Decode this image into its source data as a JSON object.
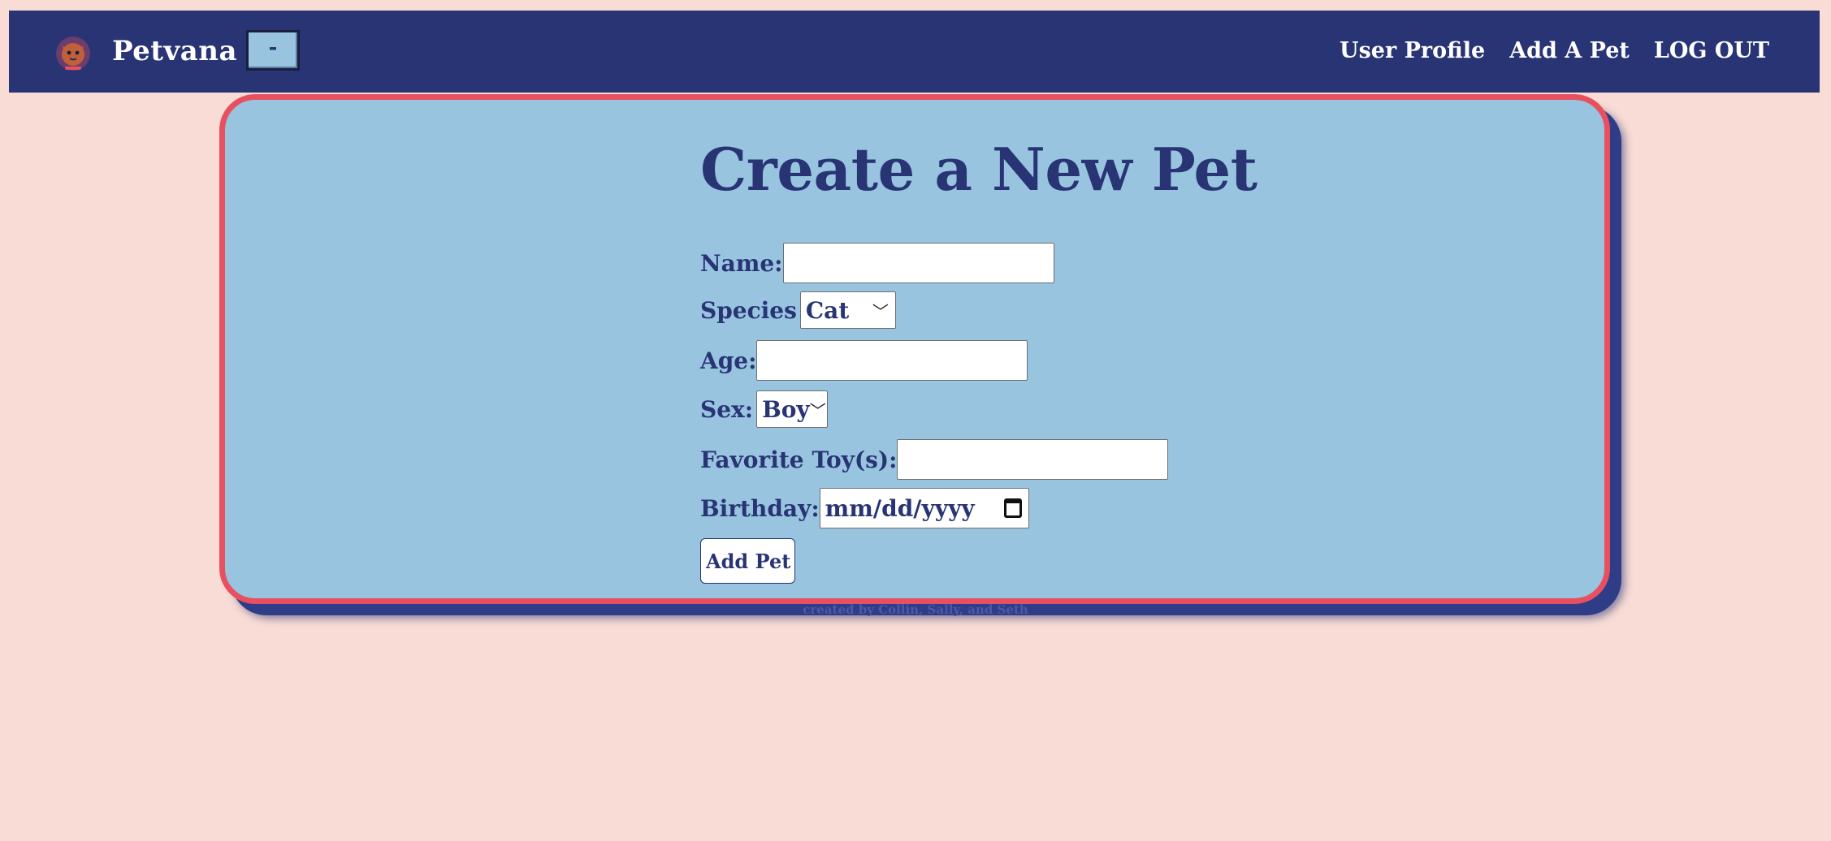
{
  "navbar": {
    "brand": "Petvana",
    "logo_icon": "pet-logo-icon",
    "toggle_label": "-",
    "links": [
      "User Profile",
      "Add A Pet",
      "LOG OUT"
    ]
  },
  "form": {
    "title": "Create a New Pet",
    "name_label": "Name:",
    "name_value": "",
    "species_label": "Species",
    "species_value": "Cat",
    "age_label": "Age:",
    "age_value": "",
    "sex_label": "Sex:",
    "sex_value": "Boy",
    "toy_label": "Favorite Toy(s):",
    "toy_value": "",
    "birthday_label": "Birthday:",
    "birthday_placeholder": "mm/dd/yyyy",
    "submit_label": "Add Pet"
  },
  "footer": {
    "credit": "created by Collin, Sally, and Seth"
  },
  "colors": {
    "page_bg": "#f8dcd5",
    "nav_bg": "#283474",
    "card_bg": "#98c4e0",
    "card_border": "#e8505f",
    "text": "#283474"
  }
}
